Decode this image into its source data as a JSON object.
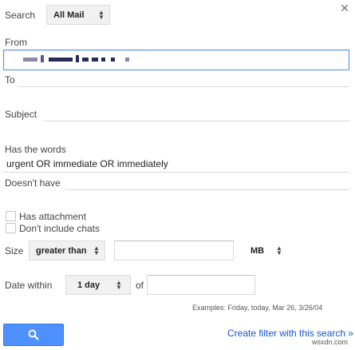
{
  "header": {
    "search_label": "Search",
    "search_scope": "All Mail"
  },
  "fields": {
    "from_label": "From",
    "to_label": "To",
    "subject_label": "Subject",
    "has_words_label": "Has the words",
    "has_words_value": "urgent OR immediate OR immediately",
    "doesnt_have_label": "Doesn't have"
  },
  "checkboxes": {
    "has_attachment": "Has attachment",
    "dont_include_chats": "Don't include chats"
  },
  "size": {
    "label": "Size",
    "comparator": "greater than",
    "unit": "MB"
  },
  "date": {
    "label": "Date within",
    "range": "1 day",
    "of_label": "of",
    "examples": "Examples: Friday, today, Mar 26, 3/26/04"
  },
  "actions": {
    "create_filter": "Create filter with this search »",
    "watermark": "wsxdn.com"
  },
  "colors": {
    "accent": "#4d90fe",
    "link": "#1155cc"
  }
}
